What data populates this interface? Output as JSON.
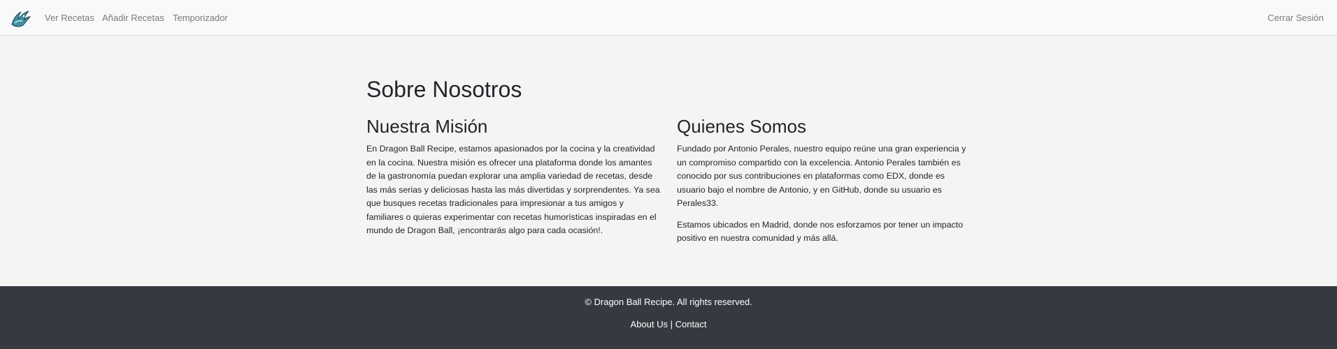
{
  "navbar": {
    "logo_icon": "dragon-logo-icon",
    "links": [
      "Ver Recetas",
      "Añadir Recetas",
      "Temporizador"
    ],
    "logout": "Cerrar Sesión"
  },
  "main": {
    "title": "Sobre Nosotros",
    "mission": {
      "heading": "Nuestra Misión",
      "text": "En Dragon Ball Recipe, estamos apasionados por la cocina y la creatividad en la cocina. Nuestra misión es ofrecer una plataforma donde los amantes de la gastronomía puedan explorar una amplia variedad de recetas, desde las más serias y deliciosas hasta las más divertidas y sorprendentes. Ya sea que busques recetas tradicionales para impresionar a tus amigos y familiares o quieras experimentar con recetas humorísticas inspiradas en el mundo de Dragon Ball, ¡encontrarás algo para cada ocasión!."
    },
    "about": {
      "heading": "Quienes Somos",
      "paragraphs": [
        "Fundado por Antonio Perales, nuestro equipo reúne una gran experiencia y un compromiso compartido con la excelencia. Antonio Perales también es conocido por sus contribuciones en plataformas como EDX, donde es usuario bajo el nombre de Antonio, y en GitHub, donde su usuario es Perales33.",
        "Estamos ubicados en Madrid, donde nos esforzamos por tener un impacto positivo en nuestra comunidad y más allá."
      ]
    }
  },
  "footer": {
    "copyright": "© Dragon Ball Recipe. All rights reserved.",
    "about_link": "About Us",
    "separator": " | ",
    "contact_link": "Contact"
  }
}
